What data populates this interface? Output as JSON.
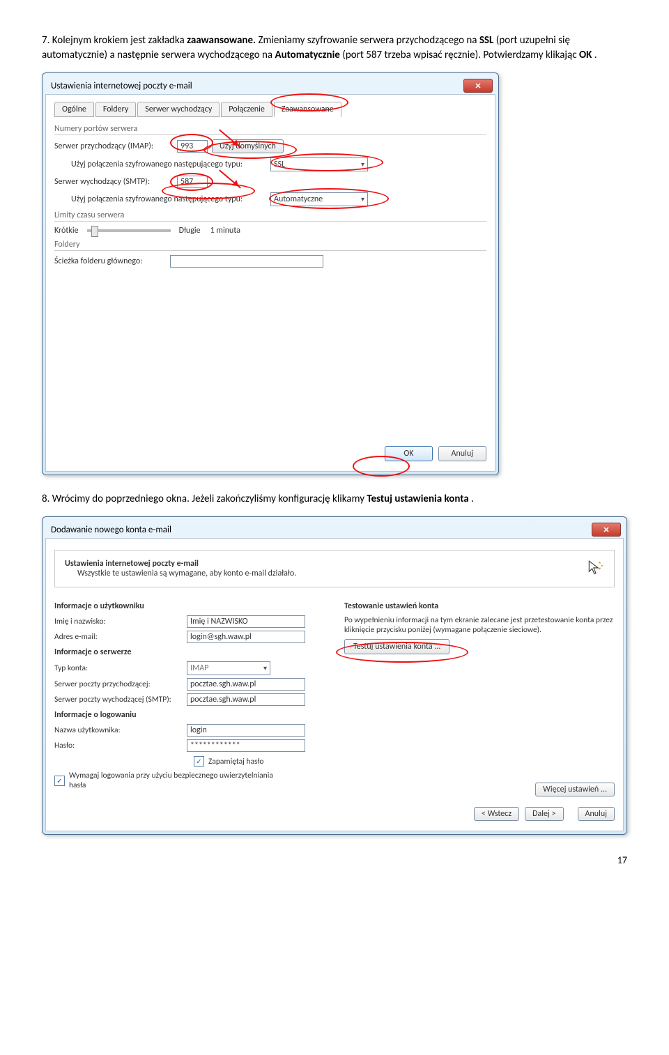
{
  "para1": {
    "prefix": "7. Kolejnym krokiem jest zakładka ",
    "bold1": "zaawansowane.",
    "mid1": " Zmieniamy szyfrowanie serwera przychodzącego na ",
    "bold2": "SSL",
    "mid2": " (port uzupełni się automatycznie) a następnie serwera wychodzącego na ",
    "bold3": "Automatycznie",
    "mid3": " (port 587 trzeba wpisać ręcznie). Potwierdzamy klikając ",
    "bold4": "OK",
    "end": "."
  },
  "dialog1": {
    "title": "Ustawienia internetowej poczty e-mail",
    "tabs": [
      "Ogólne",
      "Foldery",
      "Serwer wychodzący",
      "Połączenie",
      "Zaawansowane"
    ],
    "group_ports": "Numery portów serwera",
    "incoming_label": "Serwer przychodzący (IMAP):",
    "incoming_value": "993",
    "defaults_btn": "Użyj domyślnych",
    "enc_label": "Użyj połączenia szyfrowanego następującego typu:",
    "enc_in_value": "SSL",
    "outgoing_label": "Serwer wychodzący (SMTP):",
    "outgoing_value": "587",
    "enc_out_value": "Automatyczne",
    "group_limits": "Limity czasu serwera",
    "short": "Krótkie",
    "long": "Długie",
    "timeout": "1 minuta",
    "group_folders": "Foldery",
    "root_label": "Ścieżka folderu głównego:",
    "ok": "OK",
    "cancel": "Anuluj"
  },
  "para2": {
    "prefix": "8. Wrócimy do poprzedniego okna. Jeżeli zakończyliśmy konfigurację klikamy ",
    "bold1": "Testuj ustawienia konta",
    "end": "."
  },
  "dialog2": {
    "title": "Dodawanie nowego konta e-mail",
    "sub_title": "Ustawienia internetowej poczty e-mail",
    "sub_desc": "Wszystkie te ustawienia są wymagane, aby konto e-mail działało.",
    "h_user": "Informacje o użytkowniku",
    "l_name": "Imię i nazwisko:",
    "v_name": "Imię i NAZWISKO",
    "l_email": "Adres e-mail:",
    "v_email": "login@sgh.waw.pl",
    "h_server": "Informacje o serwerze",
    "l_type": "Typ konta:",
    "v_type": "IMAP",
    "l_incoming": "Serwer poczty przychodzącej:",
    "v_incoming": "pocztae.sgh.waw.pl",
    "l_outgoing": "Serwer poczty wychodzącej (SMTP):",
    "v_outgoing": "pocztae.sgh.waw.pl",
    "h_login": "Informacje o logowaniu",
    "l_user": "Nazwa użytkownika:",
    "v_user": "login",
    "l_pass": "Hasło:",
    "v_pass": "************",
    "remember": "Zapamiętaj hasło",
    "spa": "Wymagaj logowania przy użyciu bezpiecznego uwierzytelniania hasła",
    "h_test": "Testowanie ustawień konta",
    "test_desc": "Po wypełnieniu informacji na tym ekranie zalecane jest przetestowanie konta przez kliknięcie przycisku poniżej (wymagane połączenie sieciowe).",
    "test_btn": "Testuj ustawienia konta ...",
    "more": "Więcej ustawień ...",
    "back": "< Wstecz",
    "next": "Dalej >",
    "cancel": "Anuluj"
  },
  "page": "17"
}
